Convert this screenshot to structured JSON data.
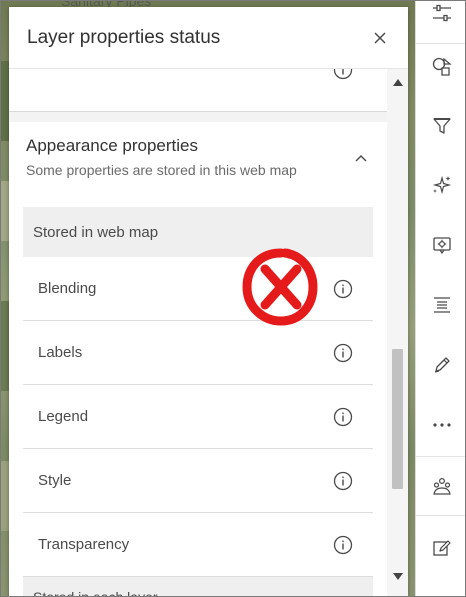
{
  "background": {
    "ghost_title": "Sanitary Pipes"
  },
  "panel": {
    "title": "Layer properties status",
    "close_label": "Close"
  },
  "appearance": {
    "title": "Appearance properties",
    "subtitle": "Some properties are stored in this web map",
    "stored_header": "Stored in web map",
    "properties": [
      {
        "label": "Blending"
      },
      {
        "label": "Labels"
      },
      {
        "label": "Legend"
      },
      {
        "label": "Style"
      },
      {
        "label": "Transparency"
      }
    ],
    "next_header": "Stored in each layer"
  },
  "toolbar": {
    "items": [
      {
        "icon": "properties-sliders-icon"
      },
      {
        "icon": "shapes-icon"
      },
      {
        "icon": "filter-icon"
      },
      {
        "icon": "effects-sparkle-icon"
      },
      {
        "icon": "configure-popups-icon"
      },
      {
        "icon": "fields-list-icon"
      },
      {
        "icon": "edit-pencil-icon"
      },
      {
        "icon": "more-icon"
      },
      {
        "icon": "clustering-icon"
      },
      {
        "icon": "sketch-edit-icon"
      }
    ]
  },
  "colors": {
    "annotation_red": "#e51b1b",
    "text": "#323232",
    "muted": "#6a6a6a"
  }
}
